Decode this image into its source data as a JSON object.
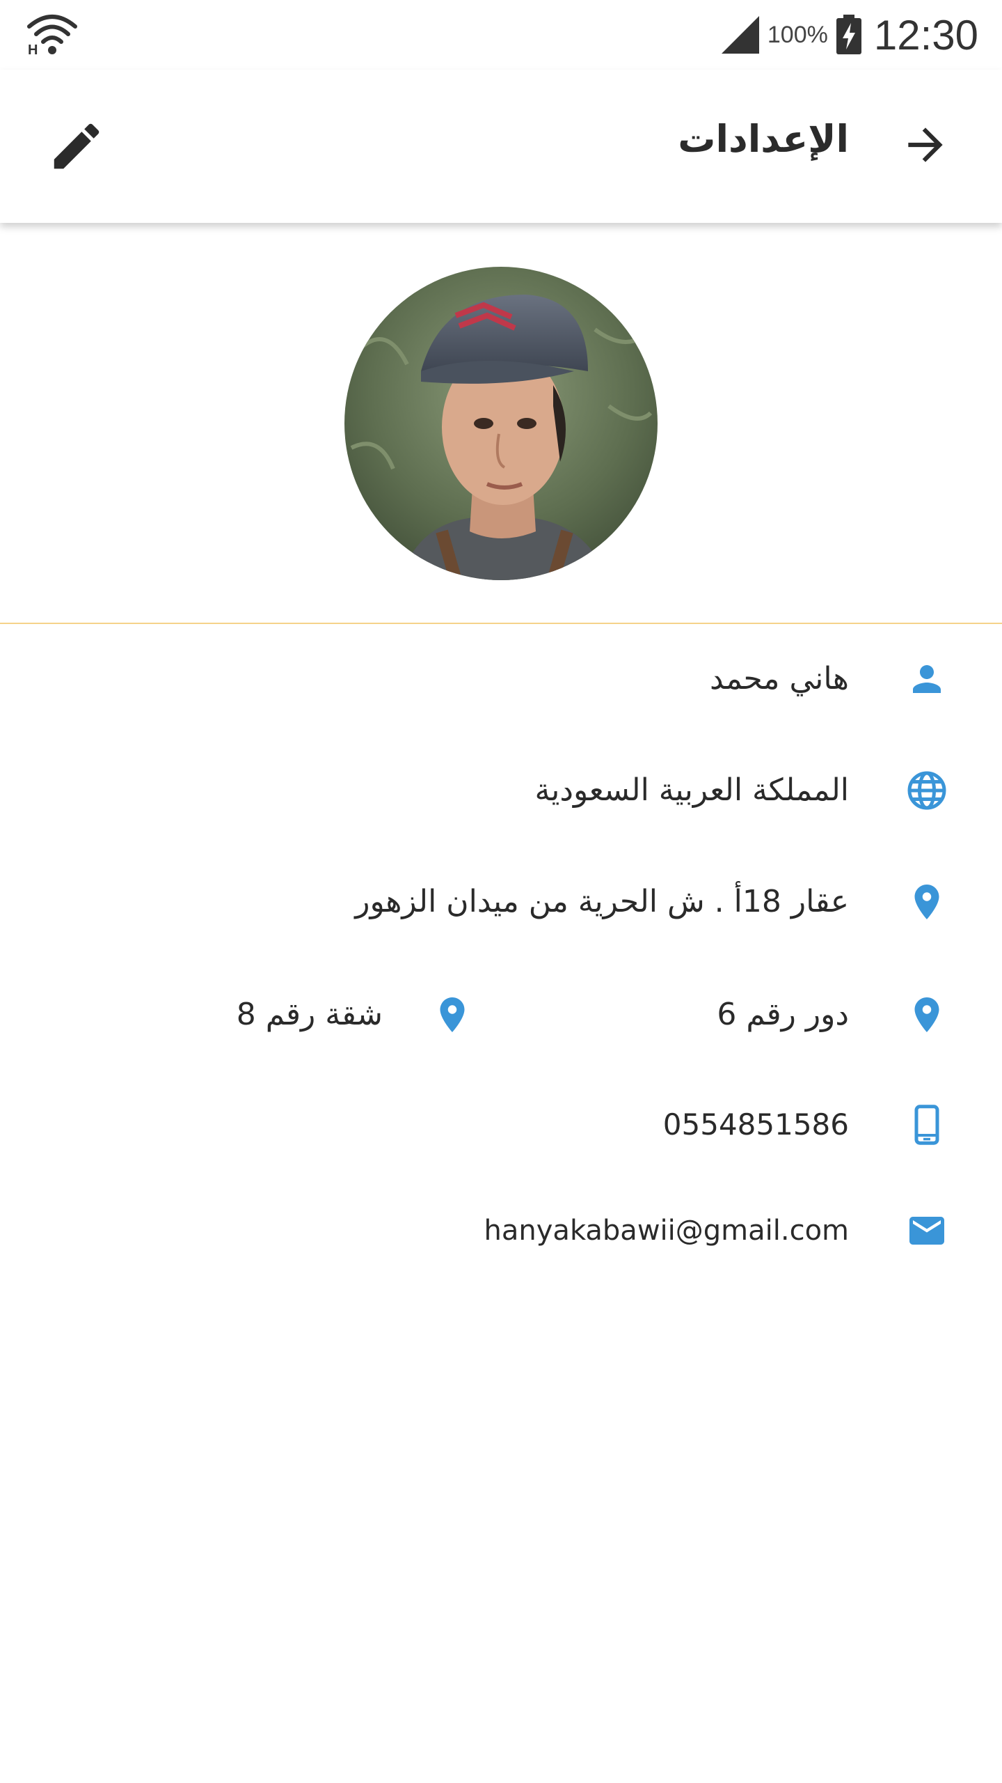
{
  "status_bar": {
    "wifi_icon": "wifi-icon",
    "signal_icon": "cell-signal-icon",
    "battery_percent": "100%",
    "battery_icon": "battery-charging-icon",
    "time": "12:30"
  },
  "app_bar": {
    "title": "الإعدادات",
    "back_icon": "arrow-forward-icon",
    "edit_icon": "pencil-icon"
  },
  "profile": {
    "avatar": "user-avatar-photo"
  },
  "accent_color": "#3a95d8",
  "divider_color": "#f5d28a",
  "info": {
    "name": {
      "icon": "person-icon",
      "value": "هاني محمد"
    },
    "country": {
      "icon": "globe-icon",
      "value": "المملكة العربية السعودية"
    },
    "address": {
      "icon": "location-pin-icon",
      "value": "عقار 18أ . ش الحرية من ميدان الزهور"
    },
    "floor": {
      "icon": "location-pin-icon",
      "value": "دور رقم 6"
    },
    "apartment": {
      "icon": "location-pin-icon",
      "value": "شقة رقم 8"
    },
    "phone": {
      "icon": "smartphone-icon",
      "value": "0554851586"
    },
    "email": {
      "icon": "email-icon",
      "value": "hanyakabawii@gmail.com"
    }
  }
}
